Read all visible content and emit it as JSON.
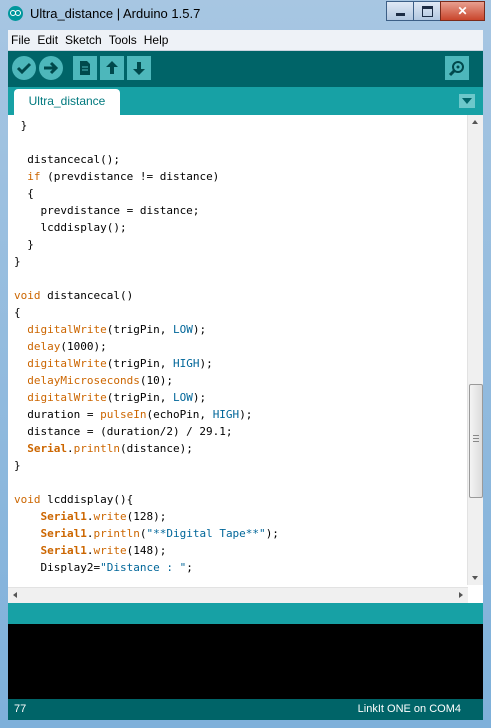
{
  "window": {
    "title": "Ultra_distance | Arduino 1.5.7",
    "controls": {
      "minimize": "minimize",
      "maximize": "maximize",
      "close": "✕"
    }
  },
  "menu": [
    "File",
    "Edit",
    "Sketch",
    "Tools",
    "Help"
  ],
  "toolbar": {
    "buttons": [
      "verify-icon",
      "upload-icon",
      "new-icon",
      "open-icon",
      "save-icon",
      "serial-monitor-icon"
    ]
  },
  "tabs": [
    {
      "label": "Ultra_distance",
      "active": true
    }
  ],
  "editor": {
    "lines": [
      [
        {
          "t": " }"
        }
      ],
      [
        {
          "t": ""
        }
      ],
      [
        {
          "t": "  distancecal();"
        }
      ],
      [
        {
          "t": "  "
        },
        {
          "t": "if",
          "c": "kw"
        },
        {
          "t": " (prevdistance != distance)"
        }
      ],
      [
        {
          "t": "  {"
        }
      ],
      [
        {
          "t": "    prevdistance = distance;"
        }
      ],
      [
        {
          "t": "    lcddisplay();"
        }
      ],
      [
        {
          "t": "  }"
        }
      ],
      [
        {
          "t": "}"
        }
      ],
      [
        {
          "t": ""
        }
      ],
      [
        {
          "t": "void",
          "c": "kw"
        },
        {
          "t": " distancecal()"
        }
      ],
      [
        {
          "t": "{"
        }
      ],
      [
        {
          "t": "  "
        },
        {
          "t": "digitalWrite",
          "c": "kw"
        },
        {
          "t": "(trigPin, "
        },
        {
          "t": "LOW",
          "c": "cn"
        },
        {
          "t": ");"
        }
      ],
      [
        {
          "t": "  "
        },
        {
          "t": "delay",
          "c": "kw"
        },
        {
          "t": "(1000);"
        }
      ],
      [
        {
          "t": "  "
        },
        {
          "t": "digitalWrite",
          "c": "kw"
        },
        {
          "t": "(trigPin, "
        },
        {
          "t": "HIGH",
          "c": "cn"
        },
        {
          "t": ");"
        }
      ],
      [
        {
          "t": "  "
        },
        {
          "t": "delayMicroseconds",
          "c": "kw"
        },
        {
          "t": "(10);"
        }
      ],
      [
        {
          "t": "  "
        },
        {
          "t": "digitalWrite",
          "c": "kw"
        },
        {
          "t": "(trigPin, "
        },
        {
          "t": "LOW",
          "c": "cn"
        },
        {
          "t": ");"
        }
      ],
      [
        {
          "t": "  duration = "
        },
        {
          "t": "pulseIn",
          "c": "kw"
        },
        {
          "t": "(echoPin, "
        },
        {
          "t": "HIGH",
          "c": "cn"
        },
        {
          "t": ");"
        }
      ],
      [
        {
          "t": "  distance = (duration/2) / 29.1;"
        }
      ],
      [
        {
          "t": "  "
        },
        {
          "t": "Serial",
          "c": "kb"
        },
        {
          "t": "."
        },
        {
          "t": "println",
          "c": "kw"
        },
        {
          "t": "(distance);"
        }
      ],
      [
        {
          "t": "}"
        }
      ],
      [
        {
          "t": ""
        }
      ],
      [
        {
          "t": "void",
          "c": "kw"
        },
        {
          "t": " lcddisplay(){"
        }
      ],
      [
        {
          "t": "    "
        },
        {
          "t": "Serial1",
          "c": "kb"
        },
        {
          "t": "."
        },
        {
          "t": "write",
          "c": "kw"
        },
        {
          "t": "(128);"
        }
      ],
      [
        {
          "t": "    "
        },
        {
          "t": "Serial1",
          "c": "kb"
        },
        {
          "t": "."
        },
        {
          "t": "println",
          "c": "kw"
        },
        {
          "t": "("
        },
        {
          "t": "\"**Digital Tape**\"",
          "c": "st"
        },
        {
          "t": ");"
        }
      ],
      [
        {
          "t": "    "
        },
        {
          "t": "Serial1",
          "c": "kb"
        },
        {
          "t": "."
        },
        {
          "t": "write",
          "c": "kw"
        },
        {
          "t": "(148);"
        }
      ],
      [
        {
          "t": "    Display2="
        },
        {
          "t": "\"Distance : \"",
          "c": "st"
        },
        {
          "t": ";"
        }
      ]
    ]
  },
  "status": {
    "line_number": "77",
    "board": "LinkIt ONE on COM4"
  },
  "colors": {
    "teal_dark": "#006468",
    "teal_light": "#17a1a5",
    "keyword": "#cc6600",
    "constant": "#006699"
  }
}
